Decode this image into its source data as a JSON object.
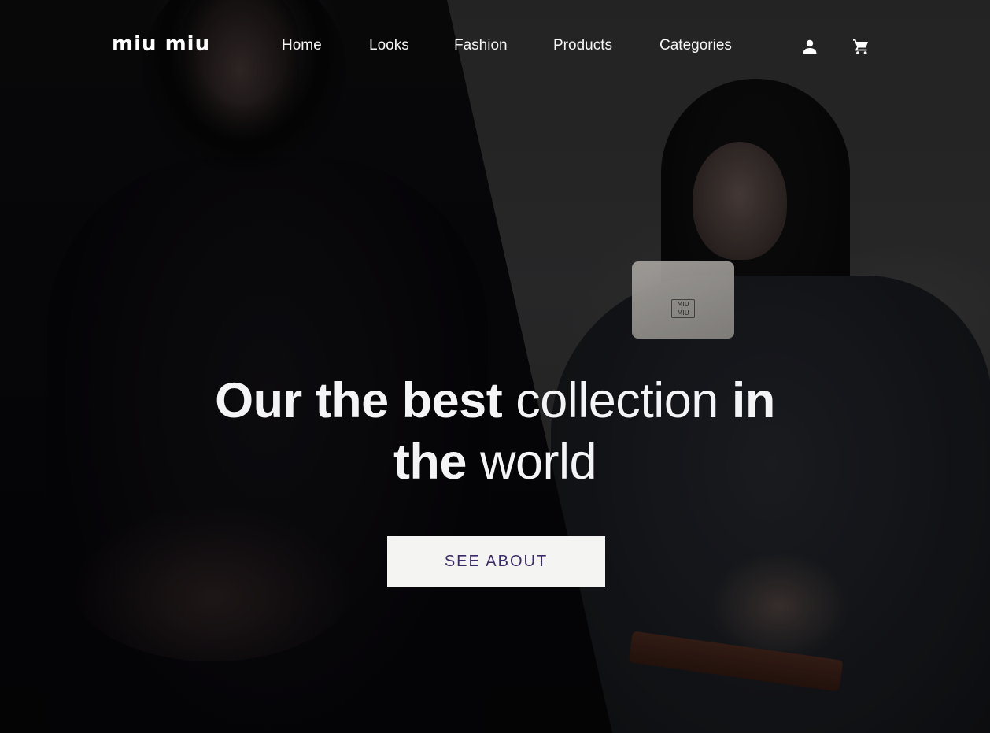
{
  "brand": {
    "logo_text": "miu miu"
  },
  "nav": {
    "items": [
      {
        "label": "Home"
      },
      {
        "label": "Looks"
      },
      {
        "label": "Fashion"
      },
      {
        "label": "Products"
      },
      {
        "label": "Categories"
      }
    ],
    "icons": {
      "account": "person-icon",
      "cart": "cart-icon"
    }
  },
  "hero": {
    "headline": {
      "line1_bold_a": "Our the best",
      "line1_light": "collection",
      "line1_bold_b": "in",
      "line2_bold": "the",
      "line2_light": "world"
    },
    "cta_label": "SEE ABOUT",
    "compact_logo": "MIU MIU"
  },
  "colors": {
    "text": "#f4f4f6",
    "cta_background": "#f4f4f2",
    "cta_text": "#3d2a6b",
    "left_panel": "#060508",
    "right_panel": "#2b2b2b"
  }
}
